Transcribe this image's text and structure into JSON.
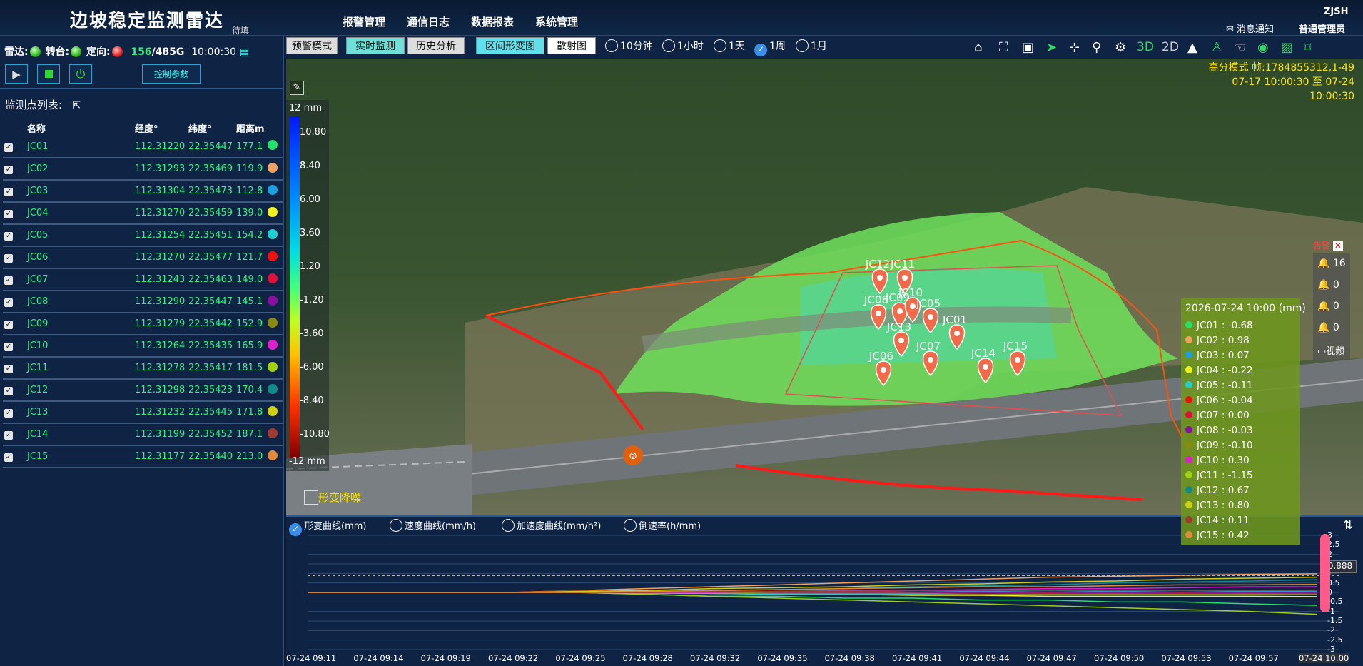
{
  "header": {
    "title": "边坡稳定监测雷达",
    "subtitle": "待填",
    "nav": [
      "报警管理",
      "通信日志",
      "数据报表",
      "系统管理"
    ],
    "company": "ZJSH",
    "notice": "消息通知",
    "user": "普通管理员"
  },
  "status": {
    "radar_label": "雷达:",
    "turntable_label": "转台:",
    "orient_label": "定向:",
    "disk_used": "156",
    "disk_total": "/485G",
    "time": "10:00:30",
    "param_button": "控制参数"
  },
  "list": {
    "title": "监测点列表:",
    "headers": [
      "名称",
      "经度°",
      "纬度°",
      "距离m"
    ],
    "rows": [
      [
        "JC01",
        "112.31220",
        "22.35447",
        "177.1",
        "#22e06a"
      ],
      [
        "JC02",
        "112.31293",
        "22.35469",
        "119.9",
        "#f0a060"
      ],
      [
        "JC03",
        "112.31304",
        "22.35473",
        "112.8",
        "#1aa0e0"
      ],
      [
        "JC04",
        "112.31270",
        "22.35459",
        "139.0",
        "#f0f020"
      ],
      [
        "JC05",
        "112.31254",
        "22.35451",
        "154.2",
        "#20d0d0"
      ],
      [
        "JC06",
        "112.31270",
        "22.35477",
        "121.7",
        "#f01010"
      ],
      [
        "JC07",
        "112.31243",
        "22.35463",
        "149.0",
        "#e0103a"
      ],
      [
        "JC08",
        "112.31290",
        "22.35447",
        "145.1",
        "#8a10a0"
      ],
      [
        "JC09",
        "112.31279",
        "22.35442",
        "152.9",
        "#8a8a10"
      ],
      [
        "JC10",
        "112.31264",
        "22.35435",
        "165.9",
        "#e020d0"
      ],
      [
        "JC11",
        "112.31278",
        "22.35417",
        "181.5",
        "#a0d010"
      ],
      [
        "JC12",
        "112.31298",
        "22.35423",
        "170.4",
        "#108a8a"
      ],
      [
        "JC13",
        "112.31232",
        "22.35445",
        "171.8",
        "#d0d010"
      ],
      [
        "JC14",
        "112.31199",
        "22.35452",
        "187.1",
        "#a03a30"
      ],
      [
        "JC15",
        "112.31177",
        "22.35440",
        "213.0",
        "#e08a3a"
      ]
    ]
  },
  "toolbar": {
    "buttons": [
      "预警模式",
      "实时监测",
      "历史分析",
      "区间形变图",
      "散射图"
    ],
    "ranges": [
      "10分钟",
      "1小时",
      "1天",
      "1周",
      "1月"
    ],
    "selected_range": "1周",
    "views": [
      "3D",
      "2D"
    ]
  },
  "map": {
    "mode": "高分模式 帧:1784855312,1-49",
    "range": "07-17 10:00:30 至 07-24 10:00:30",
    "denoise": "形变降噪",
    "scale_unit_top": "12 mm",
    "scale_unit_bottom": "-12 mm",
    "scale": [
      "10.80",
      "8.40",
      "6.00",
      "3.60",
      "1.20",
      "-1.20",
      "-3.60",
      "-6.00",
      "-8.40",
      "-10.80"
    ],
    "alerts": {
      "label": "告警",
      "blue": "16",
      "yellow": "0",
      "orange": "0",
      "red": "0",
      "video": "视频"
    },
    "pins": [
      "JC12",
      "JC11",
      "JC08",
      "JC09",
      "JC10",
      "JC05",
      "JC13",
      "JC01",
      "JC07",
      "JC14",
      "JC15",
      "JC06"
    ]
  },
  "legend": {
    "title": "2026-07-24 10:00 (mm)",
    "items": [
      "JC01 : -0.68",
      "JC02 : 0.98",
      "JC03 : 0.07",
      "JC04 : -0.22",
      "JC05 : -0.11",
      "JC06 : -0.04",
      "JC07 : 0.00",
      "JC08 : -0.03",
      "JC09 : -0.10",
      "JC10 : 0.30",
      "JC11 : -1.15",
      "JC12 : 0.67",
      "JC13 : 0.80",
      "JC14 : 0.11",
      "JC15 : 0.42"
    ]
  },
  "chart": {
    "tabs": [
      "形变曲线(mm)",
      "速度曲线(mm/h)",
      "加速度曲线(mm/h²)",
      "倒速率(h/mm)"
    ],
    "value_badge": "0.888",
    "xticks": [
      "07-24 09:11",
      "07-24 09:14",
      "07-24 09:19",
      "07-24 09:22",
      "07-24 09:25",
      "07-24 09:28",
      "07-24 09:32",
      "07-24 09:35",
      "07-24 09:38",
      "07-24 09:41",
      "07-24 09:44",
      "07-24 09:47",
      "07-24 09:50",
      "07-24 09:53",
      "07-24 09:57",
      "07-24 10:00"
    ],
    "yticks": [
      "3",
      "2.5",
      "2",
      "1.5",
      "1",
      "0.5",
      "0",
      "-0.5",
      "-1",
      "-1.5",
      "-2",
      "-2.5",
      "-3"
    ]
  },
  "chart_data": {
    "type": "line",
    "title": "",
    "xlabel": "",
    "ylabel": "形变(mm)",
    "ylim": [
      -3,
      3
    ],
    "x": [
      "07-24 09:11",
      "07-24 09:14",
      "07-24 09:19",
      "07-24 09:22",
      "07-24 09:25",
      "07-24 09:28",
      "07-24 09:32",
      "07-24 09:35",
      "07-24 09:38",
      "07-24 09:41",
      "07-24 09:44",
      "07-24 09:47",
      "07-24 09:50",
      "07-24 09:53",
      "07-24 09:57",
      "07-24 10:00"
    ],
    "series": [
      {
        "name": "JC01",
        "color": "#22e06a",
        "values": [
          0,
          0,
          0,
          0,
          0,
          -0.1,
          -0.2,
          -0.2,
          -0.3,
          -0.3,
          -0.4,
          -0.4,
          -0.5,
          -0.5,
          -0.6,
          -0.68
        ]
      },
      {
        "name": "JC02",
        "color": "#f0a060",
        "values": [
          0,
          0,
          0,
          0,
          0.1,
          0.2,
          0.3,
          0.4,
          0.5,
          0.6,
          0.7,
          0.8,
          0.85,
          0.9,
          0.95,
          0.98
        ]
      },
      {
        "name": "JC03",
        "color": "#1aa0e0",
        "values": [
          0,
          0,
          0,
          0,
          0,
          0.05,
          0,
          0.05,
          0.05,
          0.1,
          0.05,
          0.1,
          0.05,
          0.1,
          0.05,
          0.07
        ]
      },
      {
        "name": "JC04",
        "color": "#f0f020",
        "values": [
          0,
          0,
          0,
          0,
          0,
          0,
          -0.05,
          -0.1,
          -0.1,
          -0.15,
          -0.15,
          -0.2,
          -0.2,
          -0.2,
          -0.2,
          -0.22
        ]
      },
      {
        "name": "JC05",
        "color": "#20d0d0",
        "values": [
          0,
          0,
          0,
          0,
          0,
          -0.05,
          -0.05,
          -0.1,
          -0.1,
          -0.1,
          -0.1,
          -0.1,
          -0.1,
          -0.1,
          -0.1,
          -0.11
        ]
      },
      {
        "name": "JC06",
        "color": "#f01010",
        "values": [
          0,
          0,
          0,
          0,
          0.1,
          0,
          0.1,
          0,
          0.1,
          0,
          0,
          0,
          -0.05,
          0,
          -0.05,
          -0.04
        ]
      },
      {
        "name": "JC07",
        "color": "#e0103a",
        "values": [
          0,
          0,
          0,
          0,
          0,
          0,
          0,
          0,
          0,
          0,
          0,
          0,
          0,
          0,
          0,
          0
        ]
      },
      {
        "name": "JC08",
        "color": "#8a10a0",
        "values": [
          0,
          0,
          0,
          0,
          0,
          0,
          0,
          0,
          0,
          0,
          0,
          -0.05,
          0,
          -0.05,
          0,
          -0.03
        ]
      },
      {
        "name": "JC09",
        "color": "#8a8a10",
        "values": [
          0,
          0,
          0,
          0,
          0,
          0,
          0,
          -0.05,
          -0.05,
          -0.05,
          -0.1,
          -0.1,
          -0.1,
          -0.1,
          -0.1,
          -0.1
        ]
      },
      {
        "name": "JC10",
        "color": "#e020d0",
        "values": [
          0,
          0,
          0,
          0,
          0,
          0,
          0,
          0.05,
          0.1,
          0.1,
          0.15,
          0.2,
          0.2,
          0.25,
          0.3,
          0.3
        ]
      },
      {
        "name": "JC11",
        "color": "#a0d010",
        "values": [
          0,
          0,
          0,
          0,
          0,
          -0.1,
          -0.2,
          -0.3,
          -0.4,
          -0.5,
          -0.6,
          -0.7,
          -0.8,
          -0.9,
          -1.0,
          -1.15
        ]
      },
      {
        "name": "JC12",
        "color": "#108a8a",
        "values": [
          0,
          0,
          0,
          0,
          0,
          0.05,
          0.1,
          0.15,
          0.2,
          0.3,
          0.35,
          0.4,
          0.5,
          0.55,
          0.6,
          0.67
        ]
      },
      {
        "name": "JC13",
        "color": "#d0d010",
        "values": [
          0,
          0,
          0,
          0,
          0.05,
          0.1,
          0.2,
          0.25,
          0.3,
          0.4,
          0.45,
          0.55,
          0.6,
          0.7,
          0.75,
          0.8
        ]
      },
      {
        "name": "JC14",
        "color": "#a03a30",
        "values": [
          0,
          0,
          0,
          0,
          0,
          0,
          0.05,
          0.05,
          0.05,
          0.1,
          0.1,
          0.1,
          0.1,
          0.1,
          0.1,
          0.11
        ]
      },
      {
        "name": "JC15",
        "color": "#e08a3a",
        "values": [
          0,
          0,
          0,
          0,
          0,
          0.05,
          0.1,
          0.15,
          0.2,
          0.25,
          0.3,
          0.3,
          0.35,
          0.4,
          0.4,
          0.42
        ]
      }
    ]
  }
}
